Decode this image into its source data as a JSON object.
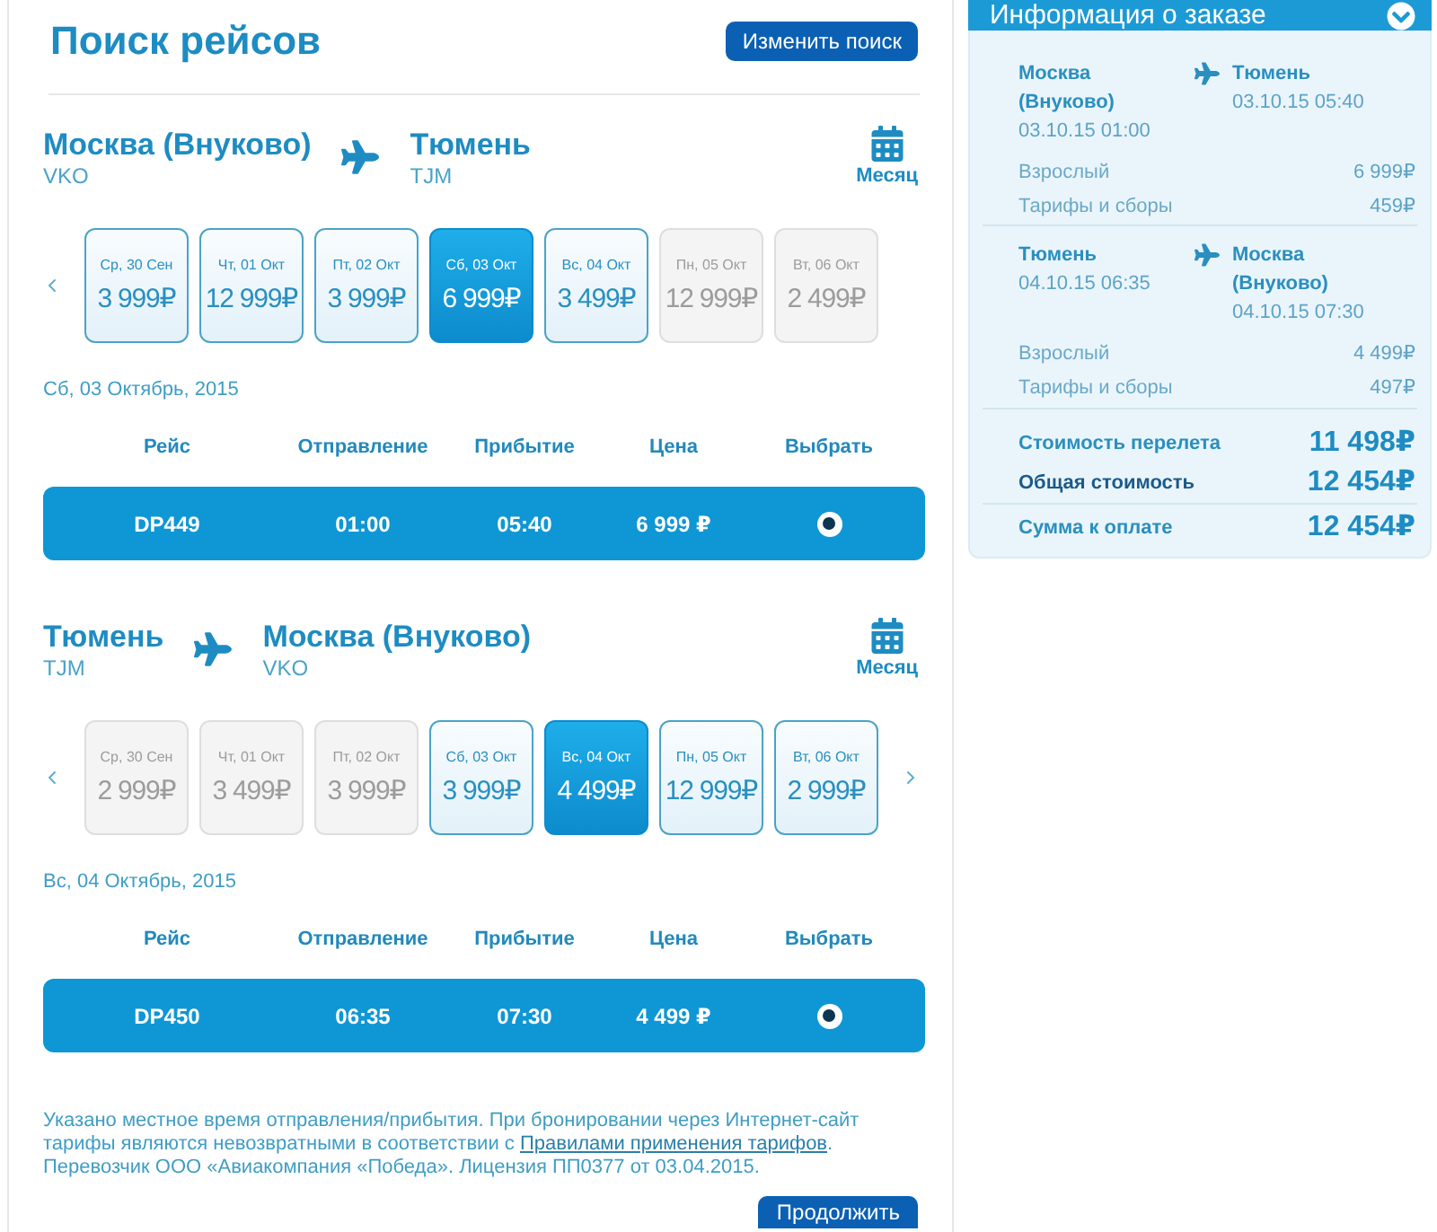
{
  "header": {
    "title": "Поиск рейсов",
    "change_button": "Изменить поиск"
  },
  "legs": [
    {
      "origin": {
        "city": "Москва (Внуково)",
        "code": "VKO"
      },
      "destination": {
        "city": "Тюмень",
        "code": "TJM"
      },
      "month_label": "Месяц",
      "prev_arrow": true,
      "next_arrow": false,
      "dates": [
        {
          "day": "Ср, 30 Сен",
          "price": "3 999₽",
          "available": true,
          "selected": false
        },
        {
          "day": "Чт, 01 Окт",
          "price": "12 999₽",
          "available": true,
          "selected": false
        },
        {
          "day": "Пт, 02 Окт",
          "price": "3 999₽",
          "available": true,
          "selected": false
        },
        {
          "day": "Сб, 03 Окт",
          "price": "6 999₽",
          "available": true,
          "selected": true
        },
        {
          "day": "Вс, 04 Окт",
          "price": "3 499₽",
          "available": true,
          "selected": false
        },
        {
          "day": "Пн, 05 Окт",
          "price": "12 999₽",
          "available": false,
          "selected": false
        },
        {
          "day": "Вт, 06 Окт",
          "price": "2 499₽",
          "available": false,
          "selected": false
        }
      ],
      "date_title": "Сб, 03 Октябрь, 2015",
      "columns": [
        "Рейс",
        "Отправление",
        "Прибытие",
        "Цена",
        "Выбрать"
      ],
      "flights": [
        {
          "number": "DP449",
          "departure": "01:00",
          "arrival": "05:40",
          "price": "6 999 ₽",
          "selected": true
        }
      ]
    },
    {
      "origin": {
        "city": "Тюмень",
        "code": "TJM"
      },
      "destination": {
        "city": "Москва (Внуково)",
        "code": "VKO"
      },
      "month_label": "Месяц",
      "prev_arrow": true,
      "next_arrow": true,
      "dates": [
        {
          "day": "Ср, 30 Сен",
          "price": "2 999₽",
          "available": false,
          "selected": false
        },
        {
          "day": "Чт, 01 Окт",
          "price": "3 499₽",
          "available": false,
          "selected": false
        },
        {
          "day": "Пт, 02 Окт",
          "price": "3 999₽",
          "available": false,
          "selected": false
        },
        {
          "day": "Сб, 03 Окт",
          "price": "3 999₽",
          "available": true,
          "selected": false
        },
        {
          "day": "Вс, 04 Окт",
          "price": "4 499₽",
          "available": true,
          "selected": true
        },
        {
          "day": "Пн, 05 Окт",
          "price": "12 999₽",
          "available": true,
          "selected": false
        },
        {
          "day": "Вт, 06 Окт",
          "price": "2 999₽",
          "available": true,
          "selected": false
        }
      ],
      "date_title": "Вс, 04 Октябрь, 2015",
      "columns": [
        "Рейс",
        "Отправление",
        "Прибытие",
        "Цена",
        "Выбрать"
      ],
      "flights": [
        {
          "number": "DP450",
          "departure": "06:35",
          "arrival": "07:30",
          "price": "4 499 ₽",
          "selected": true
        }
      ]
    }
  ],
  "notice": {
    "before_link": "Указано местное время отправления/прибытия. При бронировании через Интернет-сайт тарифы являются невозвратными в соответствии с ",
    "link": "Правилами применения тарифов",
    "after_link": ".",
    "carrier": "Перевозчик ООО «Авиакомпания «Победа». Лицензия ПП0377 от 03.04.2015."
  },
  "continue_button": "Продолжить",
  "order_info": {
    "title": "Информация о заказе",
    "expanded": true,
    "segments": [
      {
        "from": "Москва (Внуково)",
        "from_time": "03.10.15 01:00",
        "to": "Тюмень",
        "to_time": "03.10.15 05:40",
        "fares": [
          {
            "label": "Взрослый",
            "amount": "6 999₽"
          },
          {
            "label": "Тарифы и сборы",
            "amount": "459₽"
          }
        ]
      },
      {
        "from": "Тюмень",
        "from_time": "04.10.15 06:35",
        "to": "Москва (Внуково)",
        "to_time": "04.10.15 07:30",
        "fares": [
          {
            "label": "Взрослый",
            "amount": "4 499₽"
          },
          {
            "label": "Тарифы и сборы",
            "amount": "497₽"
          }
        ]
      }
    ],
    "totals": [
      {
        "kind": "flight_cost",
        "label": "Стоимость перелета",
        "amount": "11 498₽"
      },
      {
        "kind": "total",
        "label": "Общая стоимость",
        "amount": "12 454₽"
      },
      {
        "kind": "payable",
        "label": "Сумма к оплате",
        "amount": "12 454₽"
      }
    ]
  }
}
